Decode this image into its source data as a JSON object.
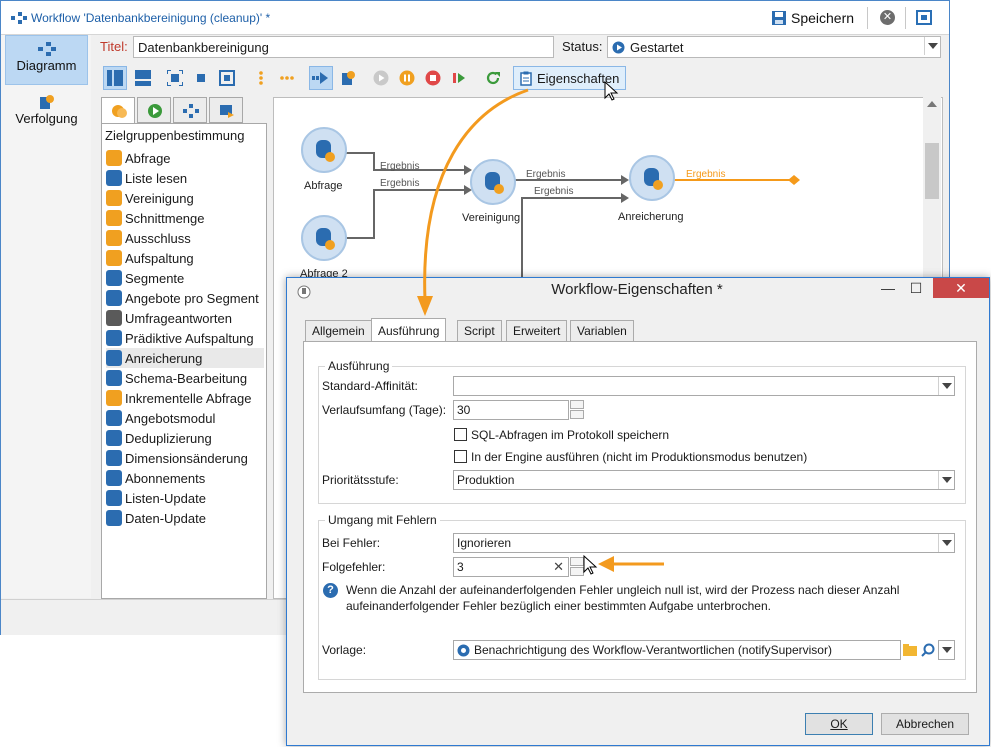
{
  "window": {
    "title": "Workflow 'Datenbankbereinigung (cleanup)' *",
    "save_label": "Speichern"
  },
  "leftnav": {
    "items": [
      {
        "label": "Diagramm",
        "active": true
      },
      {
        "label": "Verfolgung",
        "active": false
      }
    ]
  },
  "header": {
    "title_label": "Titel:",
    "title_value": "Datenbankbereinigung",
    "status_label": "Status:",
    "status_value": "Gestartet"
  },
  "toolbar": {
    "properties_label": "Eigenschaften"
  },
  "palette": {
    "heading": "Zielgruppenbestimmung",
    "items": [
      {
        "label": "Abfrage",
        "icon": "query-icon",
        "color": "#f0a020"
      },
      {
        "label": "Liste lesen",
        "icon": "read-list-icon",
        "color": "#2b6cb0"
      },
      {
        "label": "Vereinigung",
        "icon": "union-icon",
        "color": "#f0a020"
      },
      {
        "label": "Schnittmenge",
        "icon": "intersection-icon",
        "color": "#f0a020"
      },
      {
        "label": "Ausschluss",
        "icon": "exclusion-icon",
        "color": "#f0a020"
      },
      {
        "label": "Aufspaltung",
        "icon": "split-icon",
        "color": "#f0a020"
      },
      {
        "label": "Segmente",
        "icon": "segments-icon",
        "color": "#2b6cb0"
      },
      {
        "label": "Angebote pro Segment",
        "icon": "offers-per-segment-icon",
        "color": "#2b6cb0"
      },
      {
        "label": "Umfrageantworten",
        "icon": "survey-icon",
        "color": "#5a5a5a"
      },
      {
        "label": "Prädiktive Aufspaltung",
        "icon": "predictive-split-icon",
        "color": "#2b6cb0"
      },
      {
        "label": "Anreicherung",
        "icon": "enrichment-icon",
        "color": "#2b6cb0",
        "selected": true
      },
      {
        "label": "Schema-Bearbeitung",
        "icon": "schema-edit-icon",
        "color": "#2b6cb0"
      },
      {
        "label": "Inkrementelle Abfrage",
        "icon": "incremental-query-icon",
        "color": "#f0a020"
      },
      {
        "label": "Angebotsmodul",
        "icon": "offer-engine-icon",
        "color": "#2b6cb0"
      },
      {
        "label": "Deduplizierung",
        "icon": "dedup-icon",
        "color": "#2b6cb0"
      },
      {
        "label": "Dimensionsänderung",
        "icon": "dimension-change-icon",
        "color": "#2b6cb0"
      },
      {
        "label": "Abonnements",
        "icon": "subscriptions-icon",
        "color": "#2b6cb0"
      },
      {
        "label": "Listen-Update",
        "icon": "list-update-icon",
        "color": "#2b6cb0"
      },
      {
        "label": "Daten-Update",
        "icon": "data-update-icon",
        "color": "#2b6cb0"
      }
    ]
  },
  "diagram": {
    "nodes": [
      {
        "label": "Abfrage"
      },
      {
        "label": "Abfrage 2"
      },
      {
        "label": "Vereinigung"
      },
      {
        "label": "Anreicherung"
      }
    ],
    "links": [
      "Ergebnis",
      "Ergebnis",
      "Ergebnis",
      "Ergebnis",
      "Ergebnis"
    ],
    "active_link_color": "#f59a1a"
  },
  "dialog": {
    "title": "Workflow-Eigenschaften *",
    "tabs": [
      "Allgemein",
      "Ausführung",
      "Script",
      "Erweitert",
      "Variablen"
    ],
    "active_tab": "Ausführung",
    "group1": {
      "title": "Ausführung",
      "affinity_label": "Standard-Affinität:",
      "affinity_value": "",
      "history_label": "Verlaufsumfang (Tage):",
      "history_value": "30",
      "sql_log_label": "SQL-Abfragen im Protokoll speichern",
      "sql_log_checked": false,
      "engine_label": "In der Engine ausführen (nicht im Produktionsmodus benutzen)",
      "engine_checked": false,
      "priority_label": "Prioritätsstufe:",
      "priority_value": "Produktion"
    },
    "group2": {
      "title": "Umgang mit Fehlern",
      "on_error_label": "Bei Fehler:",
      "on_error_value": "Ignorieren",
      "consecutive_label": "Folgefehler:",
      "consecutive_value": "3",
      "info_text": "Wenn die Anzahl der aufeinanderfolgenden Fehler ungleich null ist, wird der Prozess nach dieser Anzahl aufeinanderfolgender Fehler bezüglich einer bestimmten Aufgabe unterbrochen.",
      "template_label": "Vorlage:",
      "template_value": "Benachrichtigung des Workflow-Verantwortlichen (notifySupervisor)"
    },
    "ok_label": "OK",
    "cancel_label": "Abbrechen"
  },
  "annotation_color": "#f39a1e"
}
